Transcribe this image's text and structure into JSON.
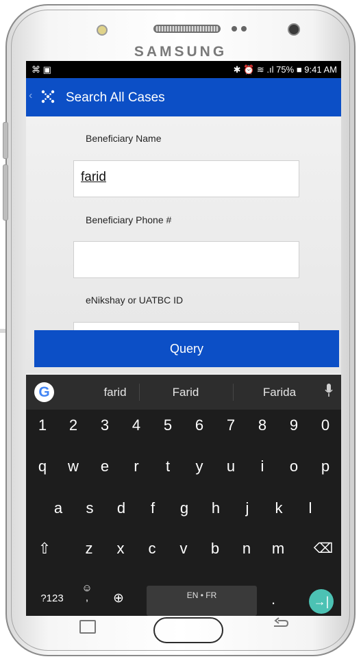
{
  "device": {
    "brand": "SAMSUNG"
  },
  "status_bar": {
    "left_icons": "⌘ ▣",
    "right_icons": "✱ ⏰ ≋ .ıl",
    "battery": "75%",
    "battery_icon": "■",
    "time": "9:41 AM"
  },
  "app_bar": {
    "back": "‹",
    "logo_icon": "enikshay-logo-icon",
    "title": "Search All Cases"
  },
  "form": {
    "name_label": "Beneficiary Name",
    "name_value": "farid",
    "phone_label": "Beneficiary Phone #",
    "phone_value": "",
    "id_label": "eNikshay or UATBC ID",
    "query_label": "Query"
  },
  "keyboard": {
    "google_icon": "G",
    "suggestions": [
      "farid",
      "Farid",
      "Farida"
    ],
    "mic_icon": "🎙",
    "row_numbers": [
      "1",
      "2",
      "3",
      "4",
      "5",
      "6",
      "7",
      "8",
      "9",
      "0"
    ],
    "row_q": [
      "q",
      "w",
      "e",
      "r",
      "t",
      "y",
      "u",
      "i",
      "o",
      "p"
    ],
    "row_a": [
      "a",
      "s",
      "d",
      "f",
      "g",
      "h",
      "j",
      "k",
      "l"
    ],
    "row_z": [
      "z",
      "x",
      "c",
      "v",
      "b",
      "n",
      "m"
    ],
    "shift": "⇧",
    "backspace": "⌫",
    "symbols": "?123",
    "emoji": "☺",
    "comma": ",",
    "globe": "⊕",
    "space_label": "EN • FR",
    "period": ".",
    "enter": "→|"
  },
  "colors": {
    "accent": "#0c4fc6",
    "enter": "#4cc2b4"
  }
}
